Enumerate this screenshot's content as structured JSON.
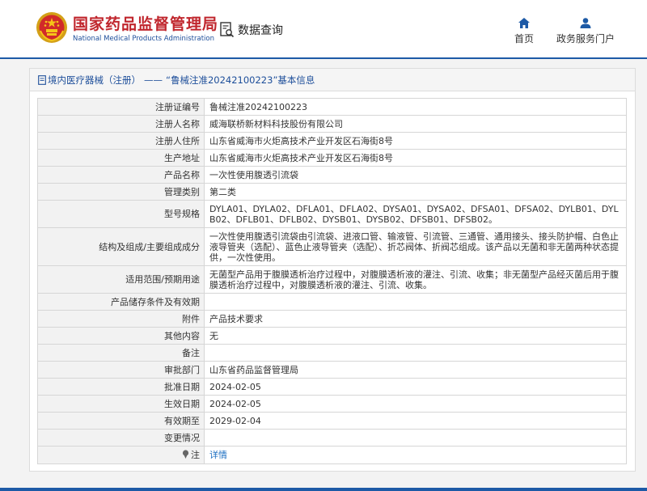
{
  "header": {
    "logo_cn": "国家药品监督管理局",
    "logo_en": "National Medical Products Administration",
    "query_label": "数据查询",
    "nav": {
      "home": "首页",
      "service": "政务服务门户"
    }
  },
  "breadcrumb": {
    "category": "境内医疗器械（注册）",
    "separator": "——",
    "title": "“鲁械注准20242100223”基本信息"
  },
  "details": [
    {
      "label": "注册证编号",
      "value": "鲁械注准20242100223"
    },
    {
      "label": "注册人名称",
      "value": "威海联桥新材料科技股份有限公司"
    },
    {
      "label": "注册人住所",
      "value": "山东省威海市火炬高技术产业开发区石海街8号"
    },
    {
      "label": "生产地址",
      "value": "山东省威海市火炬高技术产业开发区石海街8号"
    },
    {
      "label": "产品名称",
      "value": "一次性使用腹透引流袋"
    },
    {
      "label": "管理类别",
      "value": "第二类"
    },
    {
      "label": "型号规格",
      "value": "DYLA01、DYLA02、DFLA01、DFLA02、DYSA01、DYSA02、DFSA01、DFSA02、DYLB01、DYLB02、DFLB01、DFLB02、DYSB01、DYSB02、DFSB01、DFSB02。"
    },
    {
      "label": "结构及组成/主要组成成分",
      "value": "一次性使用腹透引流袋由引流袋、进液口管、输液管、引流管、三通管、通用接头、接头防护帽、白色止液导管夹（选配）、蓝色止液导管夹（选配）、折芯阀体、折阀芯组成。该产品以无菌和非无菌两种状态提供，一次性使用。"
    },
    {
      "label": "适用范围/预期用途",
      "value": "无菌型产品用于腹膜透析治疗过程中，对腹膜透析液的灌注、引流、收集；非无菌型产品经灭菌后用于腹膜透析治疗过程中，对腹膜透析液的灌注、引流、收集。"
    },
    {
      "label": "产品储存条件及有效期",
      "value": ""
    },
    {
      "label": "附件",
      "value": "产品技术要求"
    },
    {
      "label": "其他内容",
      "value": "无"
    },
    {
      "label": "备注",
      "value": ""
    },
    {
      "label": "审批部门",
      "value": "山东省药品监督管理局"
    },
    {
      "label": "批准日期",
      "value": "2024-02-05"
    },
    {
      "label": "生效日期",
      "value": "2024-02-05"
    },
    {
      "label": "有效期至",
      "value": "2029-02-04"
    },
    {
      "label": "变更情况",
      "value": ""
    }
  ],
  "note": {
    "label": "注",
    "link": "详情"
  },
  "colors": {
    "brand_blue": "#1d5aa6",
    "logo_red": "#c0262d",
    "link_blue": "#1d6fc2"
  }
}
